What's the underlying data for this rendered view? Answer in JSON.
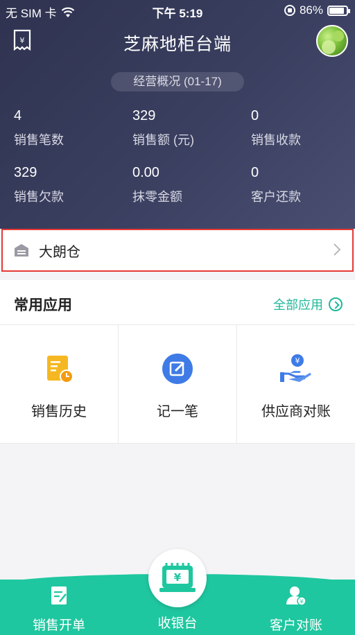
{
  "status_bar": {
    "carrier": "无 SIM 卡",
    "time": "下午 5:19",
    "battery": "86%",
    "battery_level": 0.86
  },
  "header": {
    "title": "芝麻地柜台端",
    "overview_label": "经营概况 (01-17)",
    "stats": [
      {
        "value": "4",
        "label": "销售笔数"
      },
      {
        "value": "329",
        "label": "销售额 (元)"
      },
      {
        "value": "0",
        "label": "销售收款"
      },
      {
        "value": "329",
        "label": "销售欠款"
      },
      {
        "value": "0.00",
        "label": "抹零金额"
      },
      {
        "value": "0",
        "label": "客户还款"
      }
    ]
  },
  "warehouse": {
    "name": "大朗仓",
    "icon": "warehouse-icon"
  },
  "apps_section": {
    "title": "常用应用",
    "all_apps_label": "全部应用",
    "items": [
      {
        "label": "销售历史",
        "icon": "sales-history-icon",
        "color": "#f5b822"
      },
      {
        "label": "记一笔",
        "icon": "note-edit-icon",
        "color": "#3e7be6"
      },
      {
        "label": "供应商对账",
        "icon": "supplier-payment-icon",
        "color": "#3e7be6"
      }
    ]
  },
  "tabbar": {
    "items": [
      {
        "label": "销售开单",
        "icon": "sales-order-icon"
      },
      {
        "label": "收银台",
        "icon": "cashier-icon"
      },
      {
        "label": "客户对账",
        "icon": "customer-account-icon"
      }
    ],
    "accent": "#1ec79f"
  }
}
